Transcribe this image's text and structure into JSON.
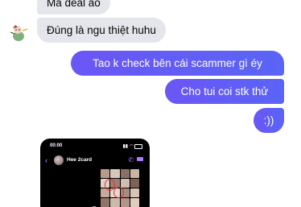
{
  "messages": {
    "incoming": [
      {
        "text": "Mà deal ảo"
      },
      {
        "text": "Đúng là ngu thiệt huhu"
      }
    ],
    "outgoing": [
      {
        "text": "Tao k check bên cái scammer gì éy"
      },
      {
        "text": "Cho tui coi stk thử"
      },
      {
        "text": ":))"
      }
    ]
  },
  "attachment": {
    "status_time": "00:00",
    "contact_name": "Hee 2card",
    "status_icons": "▮▮ ◠"
  },
  "colors": {
    "outgoing_bubble": "#5f5cf6",
    "incoming_bubble": "#e4e6eb",
    "accent": "#a97cff"
  },
  "icons": {
    "back": "chevron-left-icon",
    "call": "phone-icon",
    "video": "video-camera-icon",
    "avatar": "sticker-avatar-icon"
  }
}
